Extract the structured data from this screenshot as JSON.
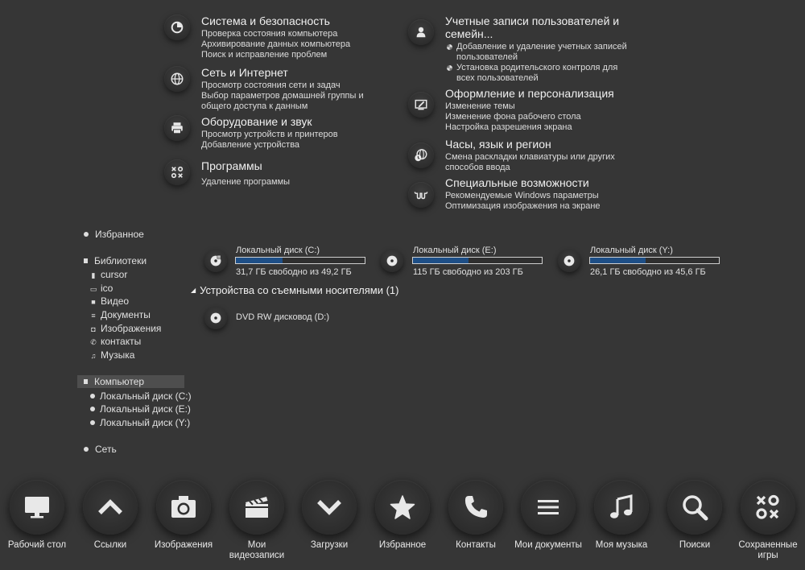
{
  "control_panel": {
    "left": [
      {
        "title": "Система и безопасность",
        "icon": "shield-icon",
        "links": [
          "Проверка состояния компьютера",
          "Архивирование данных компьютера",
          "Поиск и исправление проблем"
        ]
      },
      {
        "title": "Сеть и Интернет",
        "icon": "globe-icon",
        "links": [
          "Просмотр состояния сети и задач",
          "Выбор параметров домашней группы и общего доступа к данным"
        ]
      },
      {
        "title": "Оборудование и звук",
        "icon": "printer-icon",
        "links": [
          "Просмотр устройств и принтеров",
          "Добавление устройства"
        ]
      },
      {
        "title": "Программы",
        "icon": "games-icon",
        "links": [
          "Удаление программы"
        ]
      }
    ],
    "right": [
      {
        "title": "Учетные записи пользователей и семейн...",
        "icon": "user-icon",
        "links": [
          "Добавление и удаление учетных записей пользователей",
          "Установка родительского контроля для всех пользователей"
        ]
      },
      {
        "title": "Оформление и персонализация",
        "icon": "personalize-icon",
        "links": [
          "Изменение темы",
          "Изменение фона рабочего стола",
          "Настройка разрешения экрана"
        ]
      },
      {
        "title": "Часы, язык и регион",
        "icon": "clock-globe-icon",
        "links": [
          "Смена раскладки клавиатуры или других способов ввода"
        ]
      },
      {
        "title": "Специальные возможности",
        "icon": "glasses-icon",
        "links": [
          "Рекомендуемые Windows параметры",
          "Оптимизация изображения на экране"
        ]
      }
    ]
  },
  "nav": {
    "favorites": "Избранное",
    "libraries": "Библиотеки",
    "library_items": [
      "cursor",
      "ico",
      "Видео",
      "Документы",
      "Изображения",
      "контакты",
      "Музыка"
    ],
    "computer": "Компьютер",
    "computer_items": [
      "Локальный диск (C:)",
      "Локальный диск (E:)",
      "Локальный диск (Y:)"
    ],
    "network": "Сеть"
  },
  "drives": [
    {
      "name": "Локальный диск (C:)",
      "free": "31,7 ГБ свободно из 49,2 ГБ",
      "used_fraction": 0.36
    },
    {
      "name": "Локальный диск (E:)",
      "free": "115 ГБ свободно из 203 ГБ",
      "used_fraction": 0.43
    },
    {
      "name": "Локальный диск (Y:)",
      "free": "26,1 ГБ свободно из 45,6 ГБ",
      "used_fraction": 0.43
    }
  ],
  "removable": {
    "header": "Устройства со съемными носителями (1)",
    "dvd": "DVD RW дисковод (D:)"
  },
  "dock": [
    {
      "label": "Рабочий стол",
      "icon": "monitor-icon"
    },
    {
      "label": "Ссылки",
      "icon": "chevron-up-icon"
    },
    {
      "label": "Изображения",
      "icon": "camera-icon"
    },
    {
      "label": "Мои видеозаписи",
      "icon": "clapperboard-icon"
    },
    {
      "label": "Загрузки",
      "icon": "chevron-down-icon"
    },
    {
      "label": "Избранное",
      "icon": "star-icon"
    },
    {
      "label": "Контакты",
      "icon": "phone-icon"
    },
    {
      "label": "Мои документы",
      "icon": "list-icon"
    },
    {
      "label": "Моя музыка",
      "icon": "music-icon"
    },
    {
      "label": "Поиски",
      "icon": "search-icon"
    },
    {
      "label": "Сохраненные игры",
      "icon": "games-icon"
    }
  ],
  "colors": {
    "background": "#363636",
    "drive_bar": "#1e4f87",
    "text": "#e8e8e8"
  }
}
